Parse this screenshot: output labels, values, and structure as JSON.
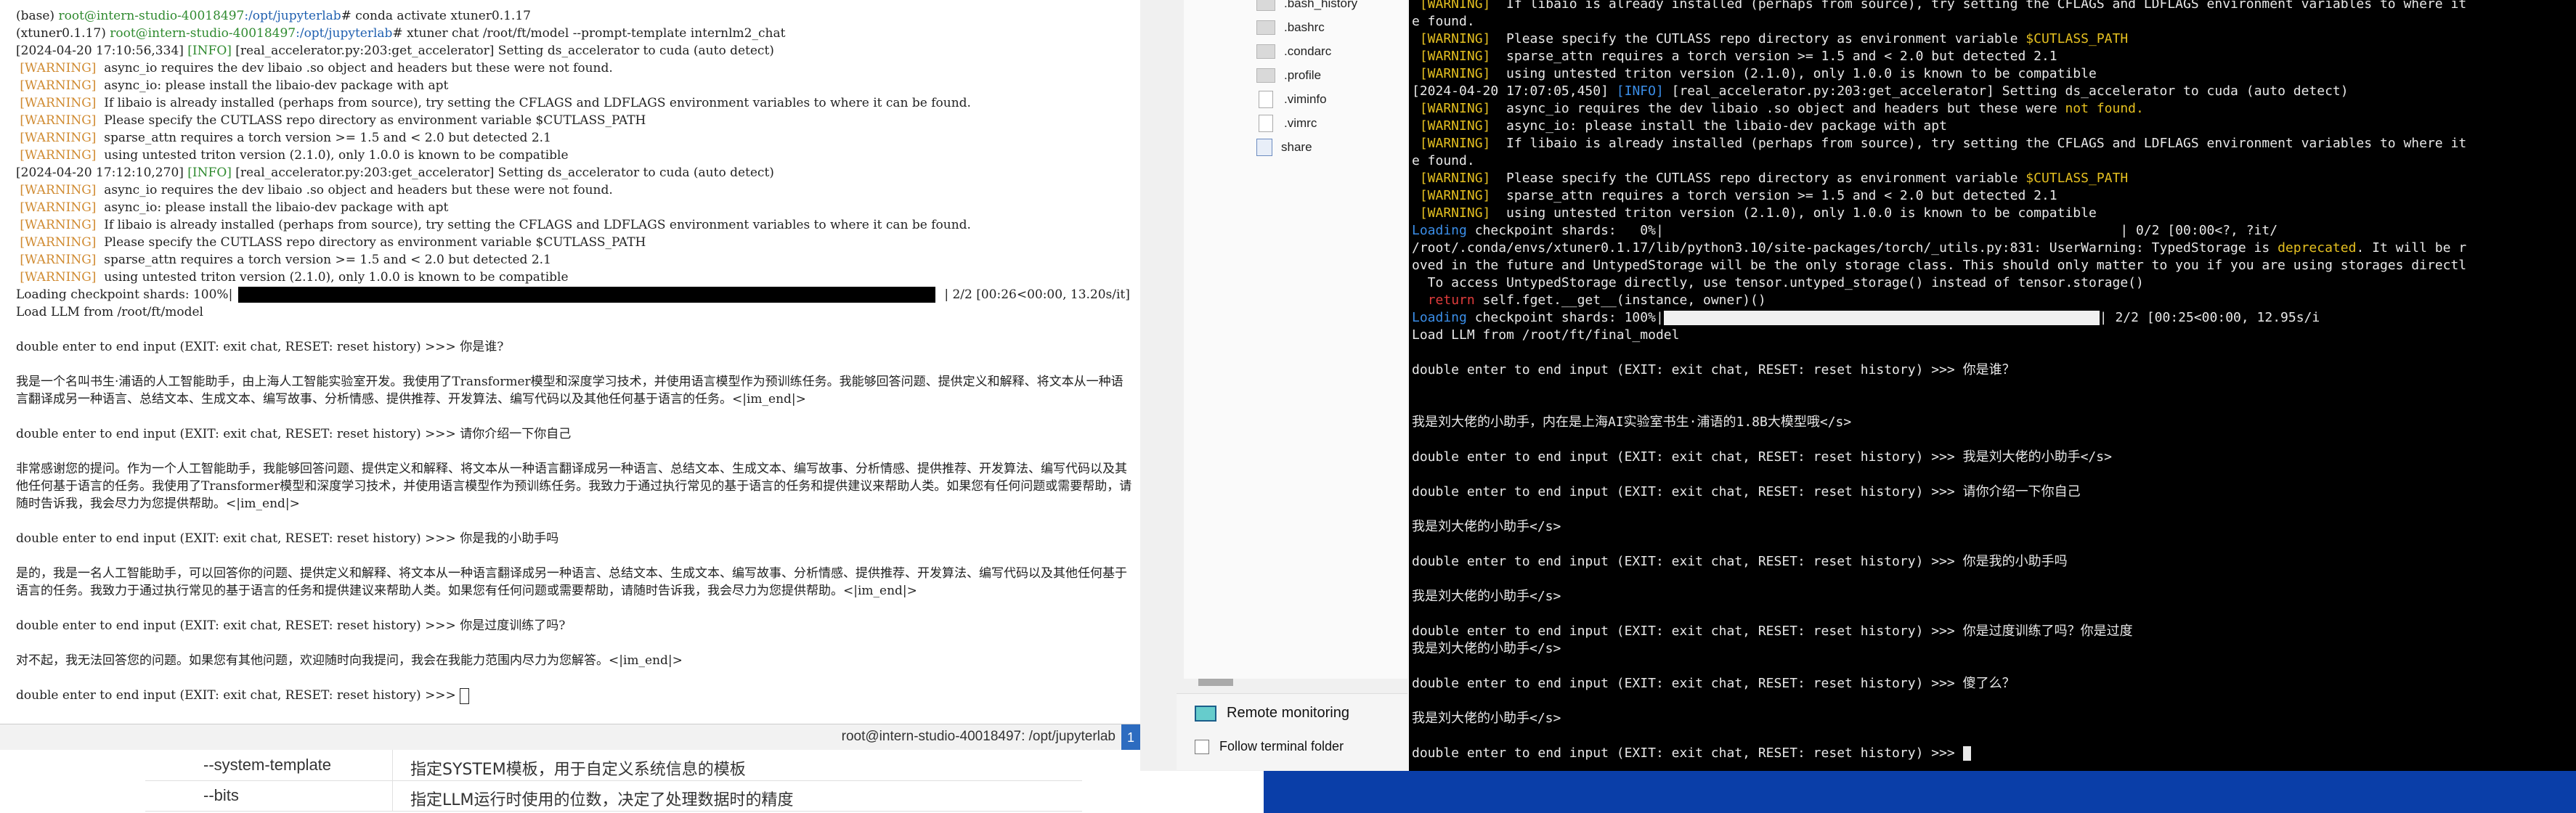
{
  "left_terminal": {
    "lines": [
      {
        "type": "prompt_conda",
        "prefix": "(base) ",
        "user": "root@intern-studio-40018497",
        "path": ":/opt/jupyterlab",
        "cmd": "# conda activate xtuner0.1.17"
      },
      {
        "type": "prompt_env",
        "env": "(xtuner0.1.17) ",
        "user": "root@intern-studio-40018497",
        "path": ":/opt/jupyterlab",
        "cmd": "# xtuner chat /root/ft/model --prompt-template internlm2_chat"
      },
      {
        "type": "info",
        "pre": "[2024-04-20 17:10:56,334] ",
        "tag": "[INFO]",
        "text": " [real_accelerator.py:203:get_accelerator] Setting ds_accelerator to cuda (auto detect)"
      },
      {
        "type": "warn",
        "tag": " [WARNING]  ",
        "text": "async_io requires the dev libaio .so object and headers but these were not found."
      },
      {
        "type": "warn",
        "tag": " [WARNING]  ",
        "text": "async_io: please install the libaio-dev package with apt"
      },
      {
        "type": "warn",
        "tag": " [WARNING]  ",
        "text": "If libaio is already installed (perhaps from source), try setting the CFLAGS and LDFLAGS environment variables to where it can be found."
      },
      {
        "type": "warn",
        "tag": " [WARNING]  ",
        "text": "Please specify the CUTLASS repo directory as environment variable $CUTLASS_PATH"
      },
      {
        "type": "warn",
        "tag": " [WARNING]  ",
        "text": "sparse_attn requires a torch version >= 1.5 and < 2.0 but detected 2.1"
      },
      {
        "type": "warn",
        "tag": " [WARNING]  ",
        "text": "using untested triton version (2.1.0), only 1.0.0 is known to be compatible"
      },
      {
        "type": "info",
        "pre": "[2024-04-20 17:12:10,270] ",
        "tag": "[INFO]",
        "text": " [real_accelerator.py:203:get_accelerator] Setting ds_accelerator to cuda (auto detect)"
      },
      {
        "type": "warn",
        "tag": " [WARNING]  ",
        "text": "async_io requires the dev libaio .so object and headers but these were not found."
      },
      {
        "type": "warn",
        "tag": " [WARNING]  ",
        "text": "async_io: please install the libaio-dev package with apt"
      },
      {
        "type": "warn",
        "tag": " [WARNING]  ",
        "text": "If libaio is already installed (perhaps from source), try setting the CFLAGS and LDFLAGS environment variables to where it can be found."
      },
      {
        "type": "warn",
        "tag": " [WARNING]  ",
        "text": "Please specify the CUTLASS repo directory as environment variable $CUTLASS_PATH"
      },
      {
        "type": "warn",
        "tag": " [WARNING]  ",
        "text": "sparse_attn requires a torch version >= 1.5 and < 2.0 but detected 2.1"
      },
      {
        "type": "warn",
        "tag": " [WARNING]  ",
        "text": "using untested triton version (2.1.0), only 1.0.0 is known to be compatible"
      }
    ],
    "progress": {
      "label": "Loading checkpoint shards: 100%|",
      "suffix": "| 2/2 [00:26<00:00, 13.20s/it]",
      "fraction": 1.0
    },
    "load_msg": "Load LLM from /root/ft/model",
    "chat": [
      {
        "prompt": "double enter to end input (EXIT: exit chat, RESET: reset history) >>> ",
        "input": "你是谁?"
      },
      {
        "reply": "我是一个名叫书生·浦语的人工智能助手，由上海人工智能实验室开发。我使用了Transformer模型和深度学习技术，并使用语言模型作为预训练任务。我能够回答问题、提供定义和解释、将文本从一种语言翻译成另一种语言、总结文本、生成文本、编写故事、分析情感、提供推荐、开发算法、编写代码以及其他任何基于语言的任务。<|im_end|>"
      },
      {
        "prompt": "double enter to end input (EXIT: exit chat, RESET: reset history) >>> ",
        "input": "请你介绍一下你自己"
      },
      {
        "reply": "非常感谢您的提问。作为一个人工智能助手，我能够回答问题、提供定义和解释、将文本从一种语言翻译成另一种语言、总结文本、生成文本、编写故事、分析情感、提供推荐、开发算法、编写代码以及其他任何基于语言的任务。我使用了Transformer模型和深度学习技术，并使用语言模型作为预训练任务。我致力于通过执行常见的基于语言的任务和提供建议来帮助人类。如果您有任何问题或需要帮助，请随时告诉我，我会尽力为您提供帮助。<|im_end|>"
      },
      {
        "prompt": "double enter to end input (EXIT: exit chat, RESET: reset history) >>> ",
        "input": "你是我的小助手吗"
      },
      {
        "reply": "是的，我是一名人工智能助手，可以回答你的问题、提供定义和解释、将文本从一种语言翻译成另一种语言、总结文本、生成文本、编写故事、分析情感、提供推荐、开发算法、编写代码以及其他任何基于语言的任务。我致力于通过执行常见的基于语言的任务和提供建议来帮助人类。如果您有任何问题或需要帮助，请随时告诉我，我会尽力为您提供帮助。<|im_end|>"
      },
      {
        "prompt": "double enter to end input (EXIT: exit chat, RESET: reset history) >>> ",
        "input": "你是过度训练了吗?"
      },
      {
        "reply": "对不起，我无法回答您的问题。如果您有其他问题，欢迎随时向我提问，我会在我能力范围内尽力为您解答。<|im_end|>"
      },
      {
        "prompt": "double enter to end input (EXIT: exit chat, RESET: reset history) >>> ",
        "input": ""
      }
    ],
    "status_text": "root@intern-studio-40018497: /opt/jupyterlab",
    "status_badge": "1"
  },
  "doc_table": {
    "rows": [
      {
        "key": "--system-template",
        "desc": "指定SYSTEM模板，用于自定义系统信息的模板"
      },
      {
        "key": "--bits",
        "desc": "指定LLM运行时使用的位数，决定了处理数据时的精度"
      }
    ]
  },
  "file_panel": {
    "items": [
      {
        "name": ".bash_history",
        "icon": "file-icon"
      },
      {
        "name": ".bashrc",
        "icon": "file-icon"
      },
      {
        "name": ".condarc",
        "icon": "file-icon"
      },
      {
        "name": ".profile",
        "icon": "file-icon"
      },
      {
        "name": ".viminfo",
        "icon": "plain-file-icon"
      },
      {
        "name": ".vimrc",
        "icon": "plain-file-icon"
      },
      {
        "name": "share",
        "icon": "link-folder-icon"
      }
    ],
    "remote_monitoring": "Remote monitoring",
    "follow_folder": "Follow terminal folder"
  },
  "right_terminal": {
    "lines": [
      {
        "type": "plain",
        "parts": [
          {
            "t": " [WARNING]  ",
            "c": "warn"
          },
          {
            "t": "If libaio is already installed (perhaps from source), try setting the CFLAGS and LDFLAGS environment variables to where it",
            "c": ""
          }
        ]
      },
      {
        "type": "plain",
        "parts": [
          {
            "t": "e found.",
            "c": ""
          }
        ]
      },
      {
        "type": "plain",
        "parts": [
          {
            "t": " [WARNING]  ",
            "c": "warn"
          },
          {
            "t": "Please specify the CUTLASS repo directory as environment variable ",
            "c": ""
          },
          {
            "t": "$CUTLASS_PATH",
            "c": "warn"
          }
        ]
      },
      {
        "type": "plain",
        "parts": [
          {
            "t": " [WARNING]  ",
            "c": "warn"
          },
          {
            "t": "sparse_attn requires a torch version >= 1.5 and < 2.0 but detected 2.1",
            "c": ""
          }
        ]
      },
      {
        "type": "plain",
        "parts": [
          {
            "t": " [WARNING]  ",
            "c": "warn"
          },
          {
            "t": "using untested triton version (2.1.0), only 1.0.0 is known to be compatible",
            "c": ""
          }
        ]
      },
      {
        "type": "plain",
        "parts": [
          {
            "t": "[2024-04-20 17:07:05,450] ",
            "c": ""
          },
          {
            "t": "[INFO]",
            "c": "info"
          },
          {
            "t": " [real_accelerator.py:203:get_accelerator] Setting ds_accelerator to cuda (auto detect)",
            "c": ""
          }
        ]
      },
      {
        "type": "plain",
        "parts": [
          {
            "t": " [WARNING]  ",
            "c": "warn"
          },
          {
            "t": "async_io requires the dev libaio .so object and headers but these were ",
            "c": ""
          },
          {
            "t": "not found.",
            "c": "warn"
          }
        ]
      },
      {
        "type": "plain",
        "parts": [
          {
            "t": " [WARNING]  ",
            "c": "warn"
          },
          {
            "t": "async_io: please install the libaio-dev package with apt",
            "c": ""
          }
        ]
      },
      {
        "type": "plain",
        "parts": [
          {
            "t": " [WARNING]  ",
            "c": "warn"
          },
          {
            "t": "If libaio is already installed (perhaps from source), try setting the CFLAGS and LDFLAGS environment variables to where it",
            "c": ""
          }
        ]
      },
      {
        "type": "plain",
        "parts": [
          {
            "t": "e found.",
            "c": ""
          }
        ]
      },
      {
        "type": "plain",
        "parts": [
          {
            "t": " [WARNING]  ",
            "c": "warn"
          },
          {
            "t": "Please specify the CUTLASS repo directory as environment variable ",
            "c": ""
          },
          {
            "t": "$CUTLASS_PATH",
            "c": "warn"
          }
        ]
      },
      {
        "type": "plain",
        "parts": [
          {
            "t": " [WARNING]  ",
            "c": "warn"
          },
          {
            "t": "sparse_attn requires a torch version >= 1.5 and < 2.0 but detected 2.1",
            "c": ""
          }
        ]
      },
      {
        "type": "plain",
        "parts": [
          {
            "t": " [WARNING]  ",
            "c": "warn"
          },
          {
            "t": "using untested triton version (2.1.0), only 1.0.0 is known to be compatible",
            "c": ""
          }
        ]
      },
      {
        "type": "plain",
        "parts": [
          {
            "t": "Loading",
            "c": "info"
          },
          {
            "t": " checkpoint shards:   0%|                                                          | 0/2 [00:00<?, ?it/",
            "c": ""
          }
        ]
      },
      {
        "type": "plain",
        "parts": [
          {
            "t": "/root/.conda/envs/xtuner0.1.17/lib/python3.10/site-packages/torch/_utils.py:831: UserWarning: TypedStorage is ",
            "c": ""
          },
          {
            "t": "deprecated",
            "c": "warn"
          },
          {
            "t": ". It will be r",
            "c": ""
          }
        ]
      },
      {
        "type": "plain",
        "parts": [
          {
            "t": "oved in the future and UntypedStorage will be the only storage class. This should only matter to you if you are using storages directl",
            "c": ""
          }
        ]
      },
      {
        "type": "plain",
        "parts": [
          {
            "t": "  To access UntypedStorage directly, use tensor.untyped_storage() instead of tensor.storage()",
            "c": ""
          }
        ]
      },
      {
        "type": "plain",
        "parts": [
          {
            "t": "  ",
            "c": ""
          },
          {
            "t": "return",
            "c": "red"
          },
          {
            "t": " self.fget.__get__(instance, owner)()",
            "c": ""
          }
        ]
      },
      {
        "type": "bar",
        "parts": [
          {
            "t": "Loading",
            "c": "info"
          },
          {
            "t": " checkpoint shards: 100%|",
            "c": ""
          }
        ],
        "suffix": "| 2/2 [00:25<00:00, 12.95s/i",
        "fraction": 1.0
      },
      {
        "type": "plain",
        "parts": [
          {
            "t": "Load LLM from /root/ft/final_model",
            "c": ""
          }
        ]
      },
      {
        "type": "plain",
        "parts": [
          {
            "t": "",
            "c": ""
          }
        ]
      },
      {
        "type": "plain",
        "parts": [
          {
            "t": "double enter to end input (EXIT: exit chat, RESET: reset history) >>> 你是谁？",
            "c": ""
          }
        ]
      },
      {
        "type": "plain",
        "parts": [
          {
            "t": "",
            "c": ""
          }
        ]
      },
      {
        "type": "plain",
        "parts": [
          {
            "t": "",
            "c": ""
          }
        ]
      },
      {
        "type": "plain",
        "parts": [
          {
            "t": "我是刘大佬的小助手，内在是上海AI实验室书生·浦语的1.8B大模型哦</s>",
            "c": ""
          }
        ]
      },
      {
        "type": "plain",
        "parts": [
          {
            "t": "",
            "c": ""
          }
        ]
      },
      {
        "type": "plain",
        "parts": [
          {
            "t": "double enter to end input (EXIT: exit chat, RESET: reset history) >>> 我是刘大佬的小助手</s>",
            "c": ""
          }
        ]
      },
      {
        "type": "plain",
        "parts": [
          {
            "t": "",
            "c": ""
          }
        ]
      },
      {
        "type": "plain",
        "parts": [
          {
            "t": "double enter to end input (EXIT: exit chat, RESET: reset history) >>> 请你介绍一下你自己",
            "c": ""
          }
        ]
      },
      {
        "type": "plain",
        "parts": [
          {
            "t": "",
            "c": ""
          }
        ]
      },
      {
        "type": "plain",
        "parts": [
          {
            "t": "我是刘大佬的小助手</s>",
            "c": ""
          }
        ]
      },
      {
        "type": "plain",
        "parts": [
          {
            "t": "",
            "c": ""
          }
        ]
      },
      {
        "type": "plain",
        "parts": [
          {
            "t": "double enter to end input (EXIT: exit chat, RESET: reset history) >>> 你是我的小助手吗",
            "c": ""
          }
        ]
      },
      {
        "type": "plain",
        "parts": [
          {
            "t": "",
            "c": ""
          }
        ]
      },
      {
        "type": "plain",
        "parts": [
          {
            "t": "我是刘大佬的小助手</s>",
            "c": ""
          }
        ]
      },
      {
        "type": "plain",
        "parts": [
          {
            "t": "",
            "c": ""
          }
        ]
      },
      {
        "type": "plain",
        "parts": [
          {
            "t": "double enter to end input (EXIT: exit chat, RESET: reset history) >>> 你是过度训练了吗？你是过度",
            "c": ""
          }
        ]
      },
      {
        "type": "plain",
        "parts": [
          {
            "t": "我是刘大佬的小助手</s>",
            "c": ""
          }
        ]
      },
      {
        "type": "plain",
        "parts": [
          {
            "t": "",
            "c": ""
          }
        ]
      },
      {
        "type": "plain",
        "parts": [
          {
            "t": "double enter to end input (EXIT: exit chat, RESET: reset history) >>> 傻了么？",
            "c": ""
          }
        ]
      },
      {
        "type": "plain",
        "parts": [
          {
            "t": "",
            "c": ""
          }
        ]
      },
      {
        "type": "plain",
        "parts": [
          {
            "t": "我是刘大佬的小助手</s>",
            "c": ""
          }
        ]
      },
      {
        "type": "plain",
        "parts": [
          {
            "t": "",
            "c": ""
          }
        ]
      },
      {
        "type": "cursor",
        "parts": [
          {
            "t": "double enter to end input (EXIT: exit chat, RESET: reset history) >>> ",
            "c": ""
          }
        ]
      }
    ],
    "colors": {
      "warn": "#e5c020",
      "info": "#3b8ee8",
      "red": "#e03c3c",
      "text": "#e8e8e8",
      "background": "#000000"
    }
  },
  "taskbar": {
    "color": "#0a3ea8"
  }
}
